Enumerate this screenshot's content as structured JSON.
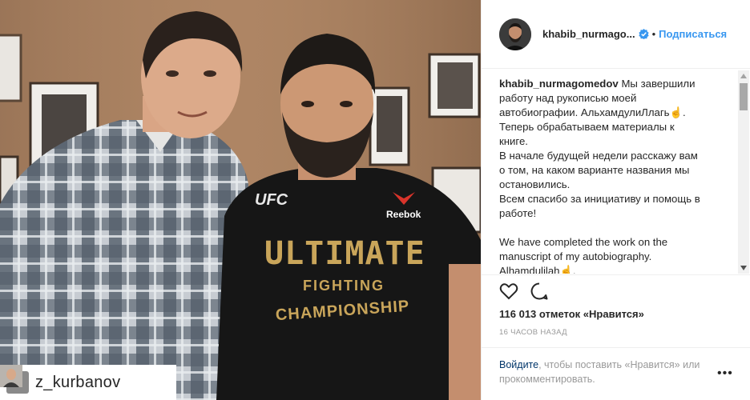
{
  "post": {
    "username": "khabib_nurmago...",
    "dot": "•",
    "follow_label": "Подписаться",
    "caption_user": "khabib_nurmagomedov",
    "caption_lines": [
      "Мы завершили",
      "работу над рукописью моей",
      "автобиографии. АльхамдулиЛлагь☝.",
      "Теперь обрабатываем материалы к",
      "книге.",
      "В начале будущей недели расскажу вам",
      "о том, на каком варианте названия мы",
      "остановились.",
      "Всем спасибо за инициативу и помощь в",
      "работе!",
      "",
      "We have completed the work on the",
      "manuscript of my autobiography.",
      "Alhamdulilah☝."
    ],
    "likes": "116 013 отметок «Нравится»",
    "time": "16 ЧАСОВ НАЗАД",
    "login_link": "Войдите",
    "login_rest": ", чтобы поставить «Нравится» или прокомментировать.",
    "more": "•••"
  },
  "repost": {
    "username": "z_kurbanov"
  },
  "photo": {
    "shirt_line1": "ULTIMATE",
    "shirt_line2": "FIGHTING",
    "shirt_line3": "CHAMPIONSHIP",
    "ufc_logo": "UFC",
    "reebok_logo": "Reebok"
  },
  "colors": {
    "link_blue": "#3897f0",
    "dark_link": "#003569",
    "gold": "#c9a55a"
  },
  "icons": [
    "verified-badge-icon",
    "heart-icon",
    "comment-icon",
    "repost-icon",
    "more-options-icon"
  ]
}
